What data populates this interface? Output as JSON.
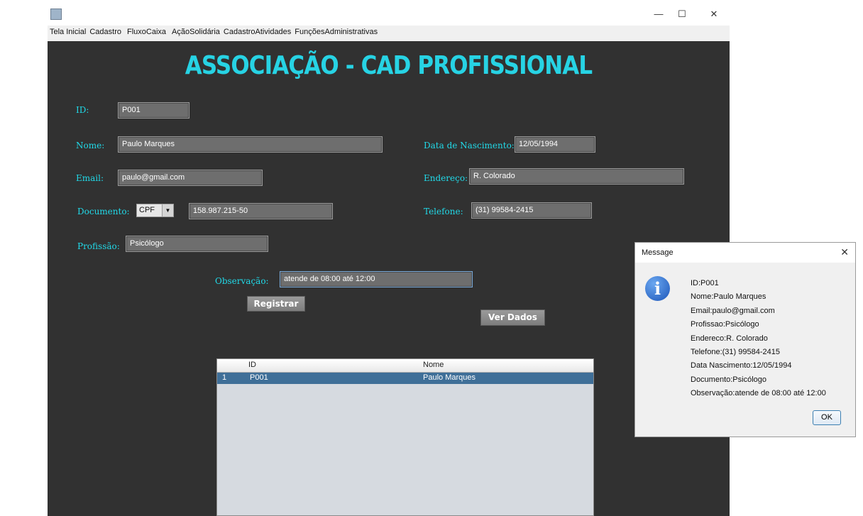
{
  "window": {
    "controls": {
      "minimize": "—",
      "maximize": "☐",
      "close": "✕"
    }
  },
  "menu": [
    "Tela Inicial",
    "Cadastro",
    "FluxoCaixa",
    "AçãoSolidária",
    "CadastroAtividades",
    "FunçõesAdministrativas"
  ],
  "form": {
    "title": "ASSOCIAÇÃO - CAD PROFISSIONAL",
    "id": {
      "label": "ID:",
      "value": "P001"
    },
    "nome": {
      "label": "Nome:",
      "value": "Paulo Marques"
    },
    "nascimento": {
      "label": "Data de Nascimento:",
      "value": "12/05/1994"
    },
    "email": {
      "label": "Email:",
      "value": "paulo@gmail.com"
    },
    "endereco": {
      "label": "Endereço:",
      "value": "R. Colorado"
    },
    "documento": {
      "label": "Documento:",
      "type_selected": "CPF",
      "value": "158.987.215-50"
    },
    "telefone": {
      "label": "Telefone:",
      "value": "(31) 99584-2415"
    },
    "profissao": {
      "label": "Profissão:",
      "value": "Psicólogo"
    },
    "observacao": {
      "label": "Observação:",
      "value": "atende de 08:00 até 12:00"
    },
    "registrar_label": "Registrar",
    "ver_dados_label": "Ver Dados"
  },
  "table": {
    "columns": [
      "",
      "ID",
      "Nome"
    ],
    "rows": [
      {
        "num": "1",
        "id": "P001",
        "nome": "Paulo Marques"
      }
    ]
  },
  "dialog": {
    "title": "Message",
    "close": "✕",
    "icon": "info-icon",
    "lines": [
      "ID:P001",
      "Nome:Paulo Marques",
      "Email:paulo@gmail.com",
      "Profissao:Psicólogo",
      "Endereco:R. Colorado",
      "Telefone:(31) 99584-2415",
      "Data Nascimento:12/05/1994",
      "Documento:Psicólogo",
      "Observação:atende de 08:00 até 12:00"
    ],
    "ok_label": "OK"
  },
  "colors": {
    "accent_text": "#21d9e8",
    "background": "#313131",
    "selection": "#3f6f98"
  }
}
